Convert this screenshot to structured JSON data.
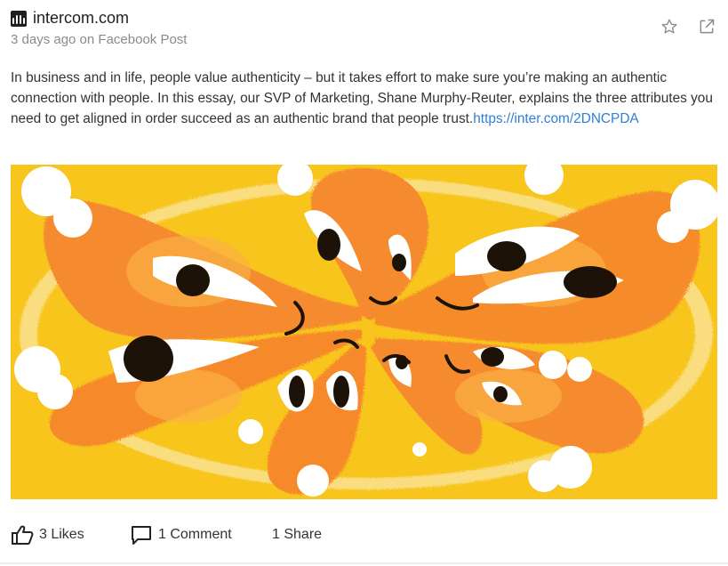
{
  "post": {
    "source": "intercom.com",
    "meta": "3 days ago on Facebook Post",
    "text": "In business and in life, people value authenticity – but it takes effort to make sure you’re making an authentic connection with people. In this essay, our SVP of Marketing, Shane Murphy-Reuter, explains the three attributes you need to get aligned in order succeed as an authentic brand that people trust.",
    "link": "https://inter.com/2DNCPDA"
  },
  "actions": {
    "star_icon": "star-icon",
    "open_icon": "external-link-icon"
  },
  "image": {
    "description_colors": {
      "background": "#f7c51b",
      "petal": "#f58a2d",
      "petal_light": "#fbb045",
      "eye_white": "#ffffff",
      "pupil": "#1c1208"
    }
  },
  "footer": {
    "likes": "3 Likes",
    "comments": "1 Comment",
    "shares": "1 Share"
  }
}
